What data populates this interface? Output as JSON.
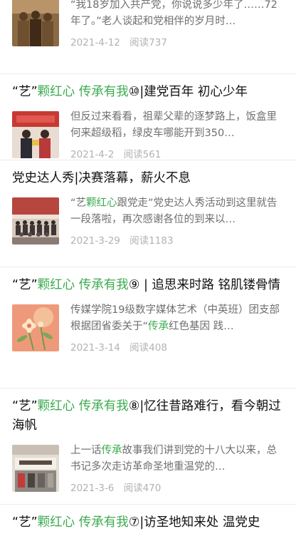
{
  "articles": [
    {
      "title_parts": [],
      "excerpt": "“我18岁加入共产党，你说说多少年了……72年了。”老人谈起和党相伴的岁月时…",
      "date": "2021-4-12",
      "reads": "阅读737"
    },
    {
      "title_parts": [
        "“艺”",
        "颗红心 传承有我",
        "⑩|建党百年 初心少年"
      ],
      "excerpt": "但反过来看看，祖辈父辈的逐梦路上，饭盒里何来超级稻，绿皮车哪能开到350…",
      "date": "2021-4-2",
      "reads": "阅读561"
    },
    {
      "title_parts": [
        "党史达人秀|决赛落幕，薪火不息"
      ],
      "excerpt_parts": [
        "“艺",
        "颗红心",
        "跟党走”党史达人秀活动到这里就告一段落啦，再次感谢各位的到来以…"
      ],
      "date": "2021-3-29",
      "reads": "阅读1183"
    },
    {
      "title_parts": [
        "“艺”",
        "颗红心 传承有我",
        "⑨ | 追思来时路 铭肌镂骨情"
      ],
      "excerpt_parts": [
        "传媒学院19级数字媒体艺术（中英班）团支部根据团省委关于“",
        "传承",
        "红色基因 践…"
      ],
      "date": "2021-3-14",
      "reads": "阅读408"
    },
    {
      "title_parts": [
        "“艺”",
        "颗红心 传承有我",
        "⑧|忆往昔路难行，看今朝过海帆"
      ],
      "excerpt_parts": [
        "上一话",
        "传承",
        "故事我们讲到党的十八大以来，总书记多次走访革命圣地重温党的…"
      ],
      "date": "2021-3-6",
      "reads": "阅读470"
    },
    {
      "title_parts": [
        "“艺”",
        "颗红心 传承有我",
        "⑦|访圣地知来处 温党史"
      ]
    }
  ],
  "icons": {
    "thumb1": "historic-group-photo",
    "thumb2": "award-ceremony-photo",
    "thumb3": "group-stage-photo",
    "thumb4": "flower-illustration",
    "thumb5": "exhibition-hall-photo"
  },
  "colors": {
    "highlight": "#3cab50",
    "meta": "#b2b2b2",
    "excerpt": "#6f6f6f"
  }
}
